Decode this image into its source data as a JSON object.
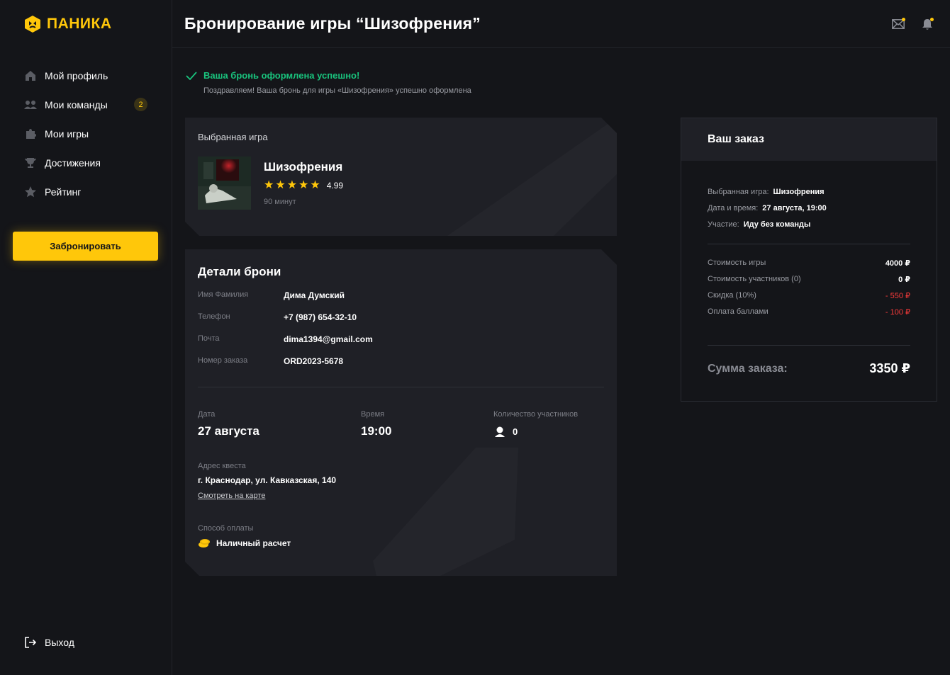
{
  "brand": {
    "name": "ПАНИКА",
    "accent": "#FFC70A"
  },
  "sidebar": {
    "items": [
      {
        "label": "Мой профиль",
        "icon": "home-icon"
      },
      {
        "label": "Мои команды",
        "icon": "team-icon",
        "badge": "2"
      },
      {
        "label": "Мои игры",
        "icon": "puzzle-icon"
      },
      {
        "label": "Достижения",
        "icon": "trophy-icon"
      },
      {
        "label": "Рейтинг",
        "icon": "star-icon"
      }
    ],
    "book_button": "Забронировать",
    "logout": "Выход"
  },
  "header": {
    "title": "Бронирование игры “Шизофрения”",
    "icons": [
      "mail-icon",
      "bell-icon"
    ]
  },
  "success": {
    "title": "Ваша бронь оформлена успешно!",
    "subtitle": "Поздравляем! Ваша бронь для игры «Шизофрения» успешно оформлена",
    "color": "#19C37D"
  },
  "game": {
    "section_label": "Выбранная игра",
    "name": "Шизофрения",
    "stars": 5,
    "rating": "4.99",
    "duration": "90 минут"
  },
  "details": {
    "title": "Детали брони",
    "fields": [
      {
        "label": "Имя Фамилия",
        "value": "Дима Думский"
      },
      {
        "label": "Телефон",
        "value": "+7 (987) 654-32-10"
      },
      {
        "label": "Почта",
        "value": "dima1394@gmail.com"
      },
      {
        "label": "Номер заказа",
        "value": "ORD2023-5678"
      }
    ],
    "date_label": "Дата",
    "date": "27 августа",
    "time_label": "Время",
    "time": "19:00",
    "participants_label": "Количество участников",
    "participants": "0",
    "address_label": "Адрес квеста",
    "address": "г. Краснодар, ул. Кавказская, 140",
    "map_link": "Смотреть на карте",
    "payment_label": "Способ оплаты",
    "payment": "Наличный расчет"
  },
  "order": {
    "title": "Ваш заказ",
    "info": [
      {
        "label": "Выбранная игра:",
        "value": "Шизофрения"
      },
      {
        "label": "Дата и время:",
        "value": "27 августа, 19:00"
      },
      {
        "label": "Участие:",
        "value": "Иду без команды"
      }
    ],
    "costs": [
      {
        "label": "Стоимость игры",
        "value": "4000 ₽"
      },
      {
        "label": "Стоимость участников (0)",
        "value": "0 ₽"
      },
      {
        "label": "Скидка (10%)",
        "value": "- 550 ₽"
      },
      {
        "label": "Оплата баллами",
        "value": "- 100 ₽"
      }
    ],
    "total_label": "Сумма заказа:",
    "total": "3350 ₽"
  }
}
